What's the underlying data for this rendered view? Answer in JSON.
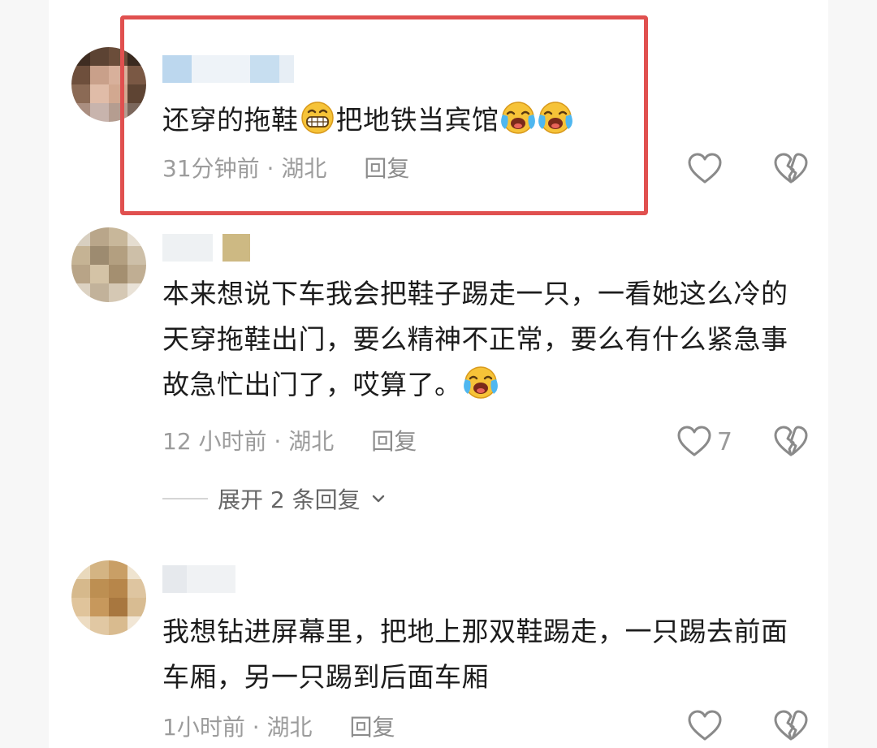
{
  "comments": [
    {
      "text_before": "还穿的拖鞋",
      "text_middle": "把地铁当宾馆",
      "emoji_grin": "grinning-face-icon",
      "emoji_cry": "loudly-crying-face-icon",
      "time": "31分钟前",
      "separator": " · ",
      "location": "湖北",
      "reply_label": "回复",
      "likes": ""
    },
    {
      "text": "本来想说下车我会把鞋子踢走一只，一看她这么冷的天穿拖鞋出门，要么精神不正常，要么有什么紧急事故急忙出门了，哎算了。",
      "emoji_cry": "loudly-crying-face-icon",
      "time": "12 小时前",
      "separator": " · ",
      "location": "湖北",
      "reply_label": "回复",
      "likes": "7",
      "expand_label": "展开 2 条回复"
    },
    {
      "text": "我想钻进屏幕里，把地上那双鞋踢走，一只踢去前面车厢，另一只踢到后面车厢",
      "time": "1小时前",
      "separator": " · ",
      "location": "湖北",
      "reply_label": "回复",
      "likes": ""
    }
  ],
  "colors": {
    "highlight_border": "#e0504f",
    "meta_text": "#9c9c9c",
    "body_text": "#1c1c1c"
  }
}
